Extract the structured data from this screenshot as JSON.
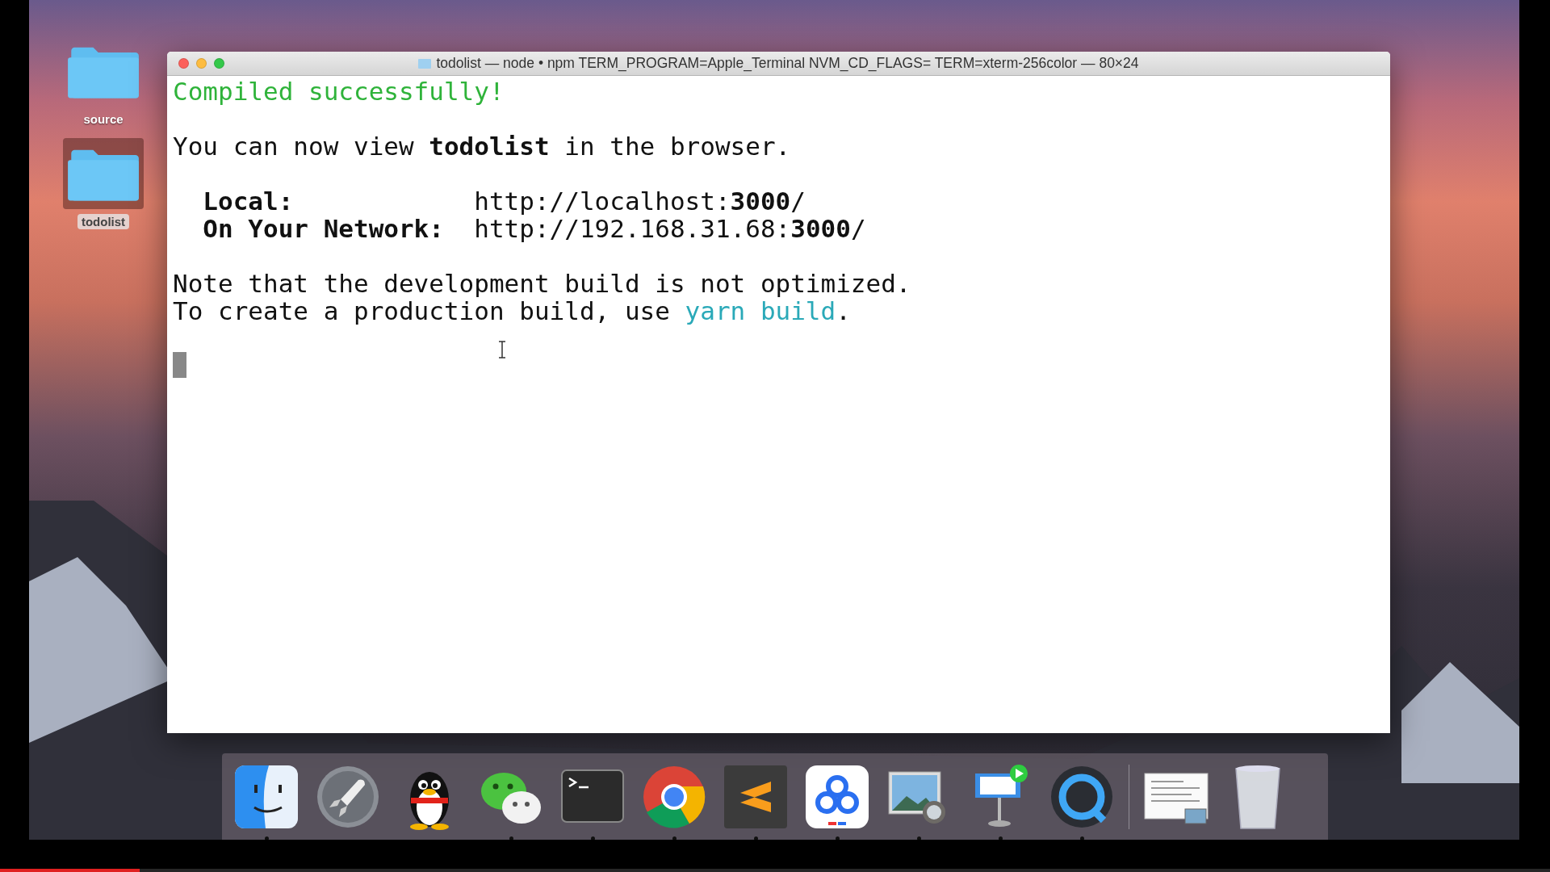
{
  "desktop_icons": [
    {
      "label": "source",
      "selected": false
    },
    {
      "label": "todolist",
      "selected": true
    }
  ],
  "window": {
    "title": "todolist — node • npm TERM_PROGRAM=Apple_Terminal NVM_CD_FLAGS= TERM=xterm-256color — 80×24"
  },
  "terminal": {
    "paragraphs": [
      [
        [
          {
            "text": "Compiled successfully!",
            "kind": "success"
          }
        ]
      ],
      [
        [
          {
            "text": "You can now view ",
            "kind": "normal"
          },
          {
            "text": "todolist",
            "kind": "strong"
          },
          {
            "text": " in the browser.",
            "kind": "normal"
          }
        ]
      ],
      [
        [
          {
            "text": "  Local:            ",
            "kind": "strong"
          },
          {
            "text": "http://localhost:",
            "kind": "normal"
          },
          {
            "text": "3000",
            "kind": "strong"
          },
          {
            "text": "/",
            "kind": "normal"
          }
        ],
        [
          {
            "text": "  On Your Network:  ",
            "kind": "strong"
          },
          {
            "text": "http://192.168.31.68:",
            "kind": "normal"
          },
          {
            "text": "3000",
            "kind": "strong"
          },
          {
            "text": "/",
            "kind": "normal"
          }
        ]
      ],
      [
        [
          {
            "text": "Note that the development build is not optimized.",
            "kind": "normal"
          }
        ],
        [
          {
            "text": "To create a production build, use ",
            "kind": "normal"
          },
          {
            "text": "yarn build",
            "kind": "command"
          },
          {
            "text": ".",
            "kind": "normal"
          }
        ]
      ]
    ]
  },
  "dock": {
    "items": [
      {
        "kind": "finder",
        "running": true
      },
      {
        "kind": "launchpad",
        "running": false
      },
      {
        "kind": "penguin",
        "running": false
      },
      {
        "kind": "chat",
        "running": true
      },
      {
        "kind": "terminal",
        "running": true
      },
      {
        "kind": "browser",
        "running": true
      },
      {
        "kind": "editor",
        "running": true
      },
      {
        "kind": "cloud",
        "running": true
      },
      {
        "kind": "preview",
        "running": true
      },
      {
        "kind": "keynote",
        "running": true
      },
      {
        "kind": "quicktime",
        "running": true
      },
      {
        "kind": "divider"
      },
      {
        "kind": "document",
        "running": false
      },
      {
        "kind": "trash",
        "running": false
      }
    ]
  },
  "video_progress": {
    "level": 0.09
  }
}
